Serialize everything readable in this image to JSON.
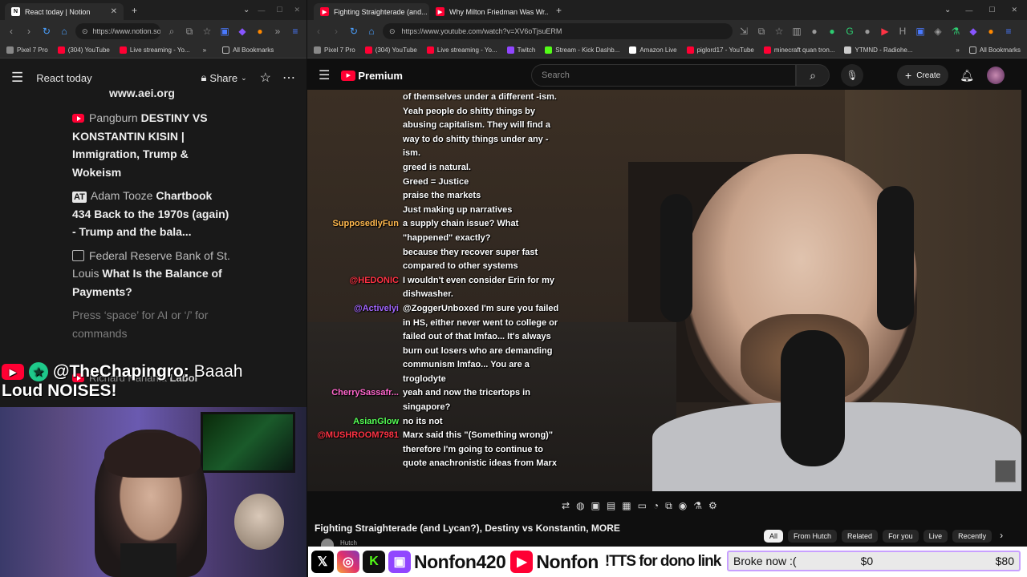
{
  "left_browser": {
    "tab_title": "React today | Notion",
    "url": "https://www.notion.so/...",
    "bookmarks": [
      "Pixel 7 Pro",
      "(304) YouTube",
      "Live streaming - Yo..."
    ],
    "all_bookmarks": "All Bookmarks"
  },
  "notion": {
    "page_title": "React today",
    "share_label": "Share",
    "url_fragment": "www.aei.org",
    "items": [
      {
        "source": "Pangburn",
        "title": "DESTINY VS KONSTANTIN KISIN | Immigration, Trump & Wokeism"
      },
      {
        "source": "Adam Tooze",
        "title": "Chartbook 434 Back to the 1970s (again) - Trump and the bala..."
      },
      {
        "source": "Federal Reserve Bank of St. Louis",
        "title": "What Is the Balance of Payments?"
      }
    ],
    "placeholder": "Press ‘space’ for AI or ‘/’ for commands",
    "partial_next": "Richard Hanania",
    "partial_next_title": "Labor"
  },
  "chat_overlay": {
    "username": "@TheChapingro:",
    "message": "Baaah Loud NOISES!"
  },
  "right_browser": {
    "tabs": [
      {
        "title": "Fighting Straighterade (and...",
        "active": true
      },
      {
        "title": "Why Milton Friedman Was Wr...",
        "active": false
      }
    ],
    "url": "https://www.youtube.com/watch?v=XV6oTjsuERM",
    "bookmarks": [
      "Pixel 7 Pro",
      "(304) YouTube",
      "Live streaming - Yo...",
      "Twitch",
      "Stream - Kick Dashb...",
      "Amazon Live",
      "piglord17 - YouTube",
      "minecraft quan tron...",
      "YTMND - Radiohe..."
    ],
    "all_bookmarks": "All Bookmarks"
  },
  "youtube": {
    "logo_text": "Premium",
    "search_placeholder": "Search",
    "create_label": "Create",
    "video_title": "Fighting Straighterade (and Lycan?), Destiny vs Konstantin, MORE",
    "channel_partial": "Hutch",
    "chips": [
      "All",
      "From Hutch",
      "Related",
      "For you",
      "Live",
      "Recently"
    ]
  },
  "chat_messages": [
    {
      "user": "",
      "color": "#ffffff",
      "text": "of themselves under a different -ism. Yeah people do shitty things by abusing capitalism. They will find a way to do shitty things under any -ism."
    },
    {
      "user": "",
      "color": "#ff4444",
      "text": "greed is natural."
    },
    {
      "user": "",
      "color": "#ff4444",
      "text": "Greed = Justice"
    },
    {
      "user": "",
      "color": "#ff4444",
      "text": "praise the markets"
    },
    {
      "user": "",
      "color": "#ff5533",
      "text": "Just making up narratives"
    },
    {
      "user": "SupposedlyFun",
      "color": "#ffb84d",
      "text": "a supply chain issue? What \"happened\" exactly?"
    },
    {
      "user": "",
      "color": "#ff4444",
      "text": "because they recover super fast compared to other systems"
    },
    {
      "user": "@HEDONIC",
      "color": "#ff3344",
      "text": "I wouldn't even consider Erin for my dishwasher."
    },
    {
      "user": "@Activelyi",
      "color": "#a266ff",
      "text": "@ZoggerUnboxed I'm sure you failed in HS, either never went to college or failed out of that lmfao... It's always burn out losers who are demanding communism lmfao... You are a troglodyte"
    },
    {
      "user": "CherrySassafr...",
      "color": "#ff66cc",
      "text": "yeah and now the tricertops in singapore?"
    },
    {
      "user": "AsianGlow",
      "color": "#55ff55",
      "text": "no its not"
    },
    {
      "user": "@MUSHROOM7981",
      "color": "#ff3344",
      "text": "Marx said this \"(Something wrong)\" therefore I'm going to continue to quote anachronistic ideas from Marx"
    }
  ],
  "banner": {
    "handle_1": "Nonfon420",
    "handle_2": "Nonfon",
    "tts_text": "!TTS for dono link",
    "goal_label": "Broke now :(",
    "goal_current": "$0",
    "goal_target": "$80"
  }
}
